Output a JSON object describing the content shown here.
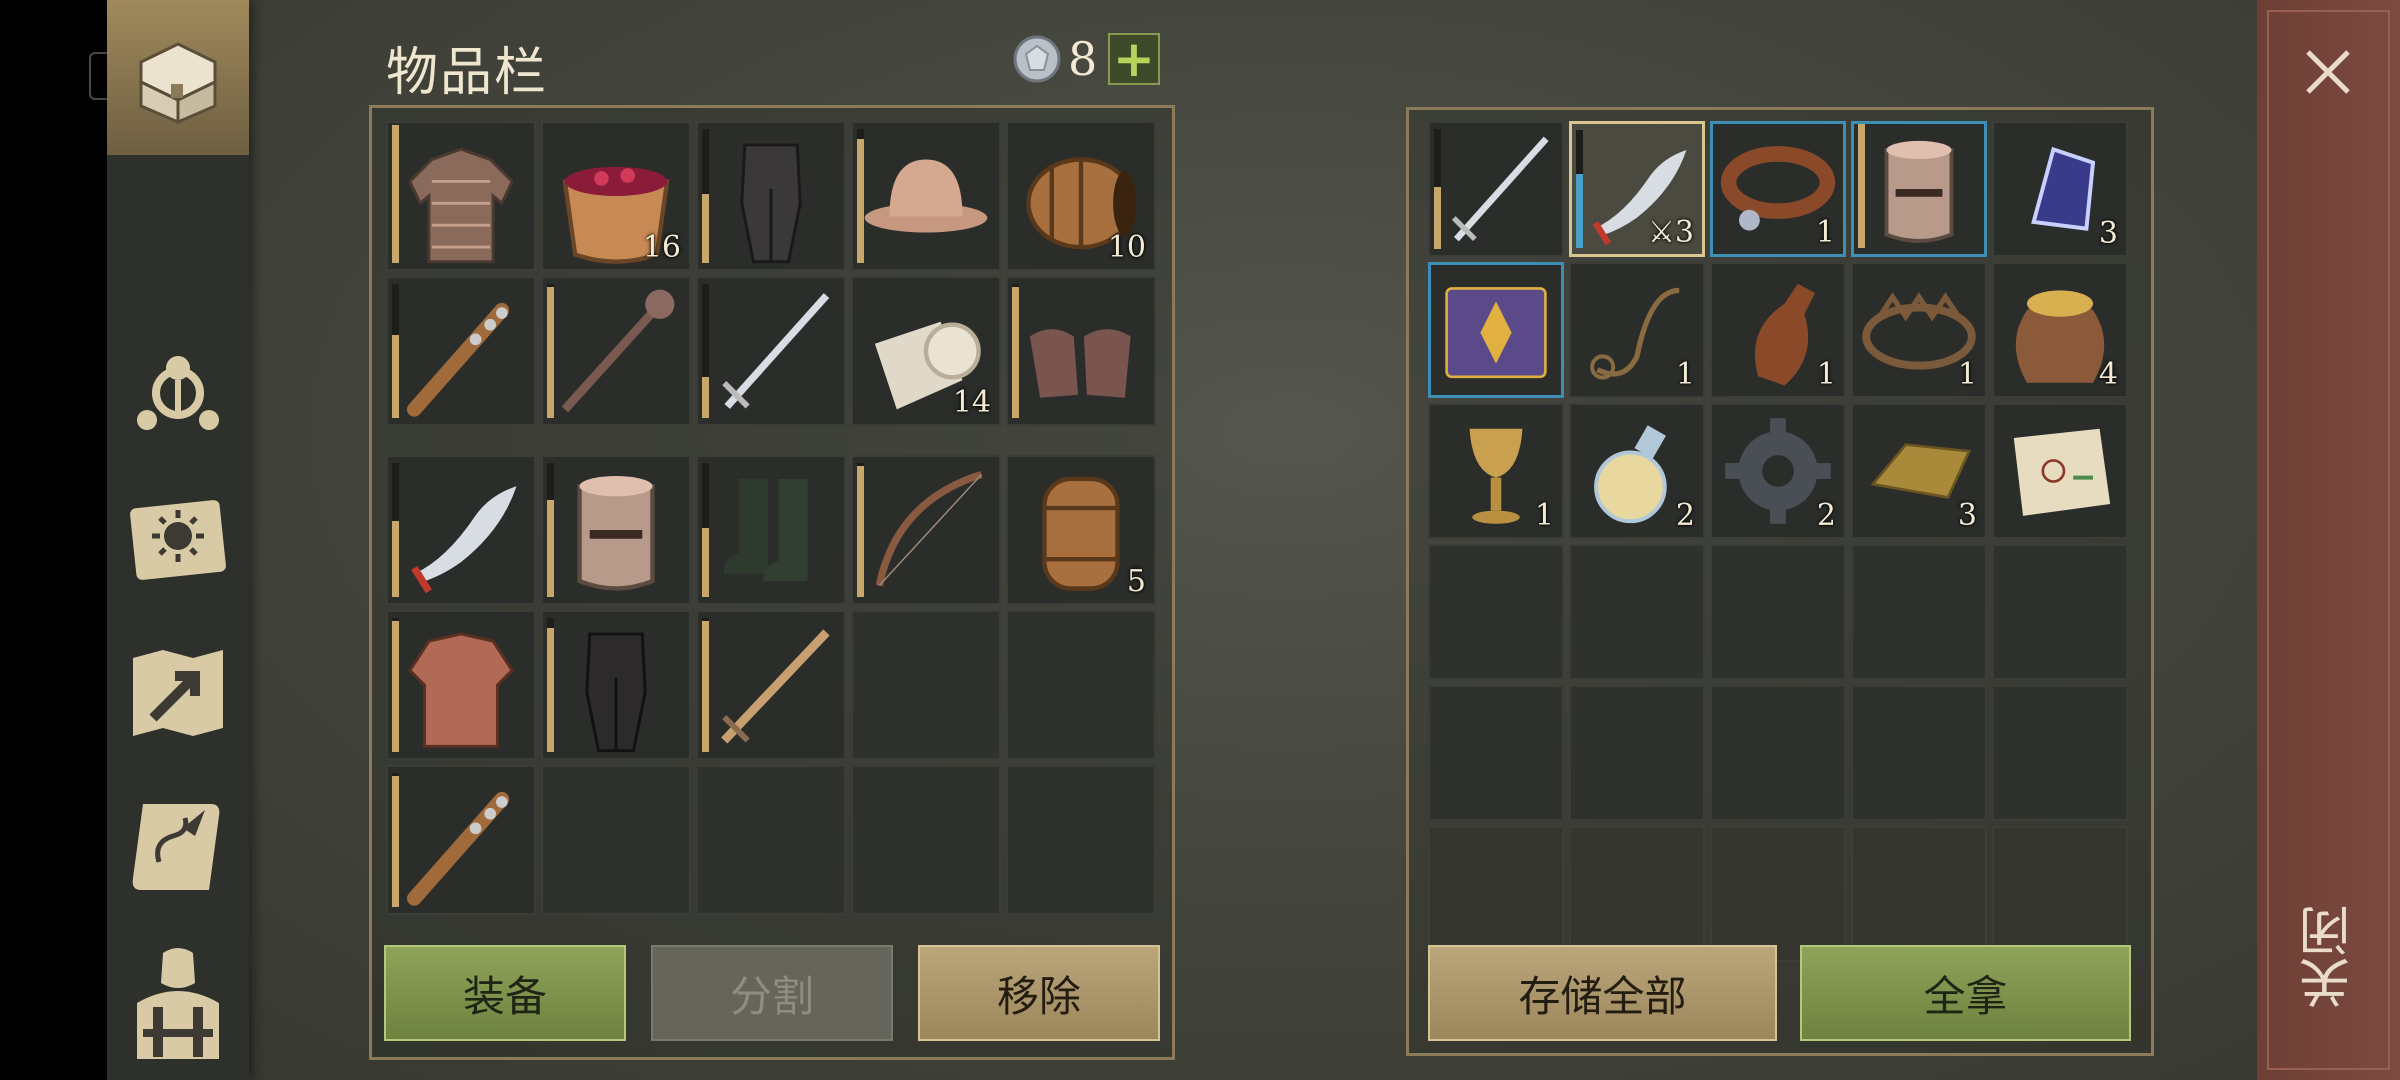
{
  "title": "物品栏",
  "currency": {
    "icon": "silver-coin-icon",
    "count": "8",
    "add_label": "+"
  },
  "sidebar": {
    "items": [
      {
        "name": "sidebar-item-inventory",
        "icon": "chest-icon",
        "active": true
      },
      {
        "name": "sidebar-item-clan",
        "icon": "clan-icon",
        "active": false
      },
      {
        "name": "sidebar-item-quests",
        "icon": "sun-book-icon",
        "active": false
      },
      {
        "name": "sidebar-item-map",
        "icon": "map-arrow-icon",
        "active": false
      },
      {
        "name": "sidebar-item-journal",
        "icon": "scroll-quill-icon",
        "active": false
      },
      {
        "name": "sidebar-item-character",
        "icon": "character-icon",
        "active": false
      }
    ]
  },
  "inventory": {
    "top_rows": [
      [
        {
          "item": "chainmail-shirt",
          "qty": "",
          "durability": 1.0
        },
        {
          "item": "berry-bowl",
          "qty": "16"
        },
        {
          "item": "dark-leggings",
          "qty": "",
          "durability": 0.5
        },
        {
          "item": "kettle-helmet",
          "qty": "",
          "durability": 0.9
        },
        {
          "item": "barrel",
          "qty": "10"
        }
      ],
      [
        {
          "item": "spiked-club",
          "qty": "",
          "durability": 0.6
        },
        {
          "item": "mace",
          "qty": "",
          "durability": 0.95
        },
        {
          "item": "longsword",
          "qty": "",
          "durability": 0.3
        },
        {
          "item": "cloth-roll",
          "qty": "14"
        },
        {
          "item": "mail-gloves",
          "qty": "",
          "durability": 0.95
        }
      ]
    ],
    "bottom_rows": [
      [
        {
          "item": "scimitar",
          "qty": "",
          "durability": 0.55
        },
        {
          "item": "great-helm",
          "qty": "",
          "durability": 0.7
        },
        {
          "item": "boots",
          "qty": "",
          "durability": 0.5
        },
        {
          "item": "bow",
          "qty": "",
          "durability": 0.95
        },
        {
          "item": "small-barrel",
          "qty": "5"
        }
      ],
      [
        {
          "item": "padded-jacket",
          "qty": "",
          "durability": 0.95
        },
        {
          "item": "cloth-pants",
          "qty": "",
          "durability": 0.9
        },
        {
          "item": "bronze-sword",
          "qty": "",
          "durability": 0.95
        },
        {
          "item": "",
          "qty": ""
        },
        {
          "item": "",
          "qty": ""
        }
      ],
      [
        {
          "item": "spiked-club",
          "qty": "",
          "durability": 0.95
        },
        {
          "item": "",
          "qty": ""
        },
        {
          "item": "",
          "qty": ""
        },
        {
          "item": "",
          "qty": ""
        },
        {
          "item": "",
          "qty": ""
        }
      ]
    ],
    "buttons": {
      "equip": "装备",
      "split": "分割",
      "remove": "移除"
    }
  },
  "storage": {
    "rows": [
      [
        {
          "item": "longsword",
          "qty": "",
          "durability": 0.5
        },
        {
          "item": "scimitar",
          "qty": "3",
          "durability": 0.6,
          "selected": true,
          "qty_prefix_icon": "sword-icon"
        },
        {
          "item": "leather-collar",
          "qty": "1",
          "highlight": "blue"
        },
        {
          "item": "great-helm",
          "qty": "",
          "highlight": "blue",
          "durability": 1.0
        },
        {
          "item": "crystal-gem",
          "qty": "3"
        }
      ],
      [
        {
          "item": "spell-book",
          "qty": "",
          "highlight": "blue"
        },
        {
          "item": "rope",
          "qty": "1"
        },
        {
          "item": "leather-flask",
          "qty": "1"
        },
        {
          "item": "bear-trap",
          "qty": "1"
        },
        {
          "item": "grain-sack",
          "qty": "4"
        }
      ],
      [
        {
          "item": "goblet",
          "qty": "1"
        },
        {
          "item": "potion",
          "qty": "2"
        },
        {
          "item": "gear",
          "qty": "2"
        },
        {
          "item": "gold-ingot",
          "qty": "3"
        },
        {
          "item": "treasure-map",
          "qty": ""
        }
      ],
      [
        {
          "item": "",
          "qty": ""
        },
        {
          "item": "",
          "qty": ""
        },
        {
          "item": "",
          "qty": ""
        },
        {
          "item": "",
          "qty": ""
        },
        {
          "item": "",
          "qty": ""
        }
      ],
      [
        {
          "item": "",
          "qty": ""
        },
        {
          "item": "",
          "qty": ""
        },
        {
          "item": "",
          "qty": ""
        },
        {
          "item": "",
          "qty": ""
        },
        {
          "item": "",
          "qty": ""
        }
      ],
      [
        {
          "item": "",
          "qty": ""
        },
        {
          "item": "",
          "qty": ""
        },
        {
          "item": "",
          "qty": ""
        },
        {
          "item": "",
          "qty": ""
        },
        {
          "item": "",
          "qty": ""
        }
      ]
    ],
    "buttons": {
      "store_all": "存储全部",
      "take_all": "全拿"
    }
  },
  "close": {
    "icon": "close-icon",
    "label": "关闭"
  },
  "colors": {
    "accent_green": "#8fa35a",
    "accent_tan": "#bba57a",
    "border_gold": "#8c7b58",
    "close_red": "#7c4a40",
    "highlight_blue": "#3e8fb5"
  }
}
